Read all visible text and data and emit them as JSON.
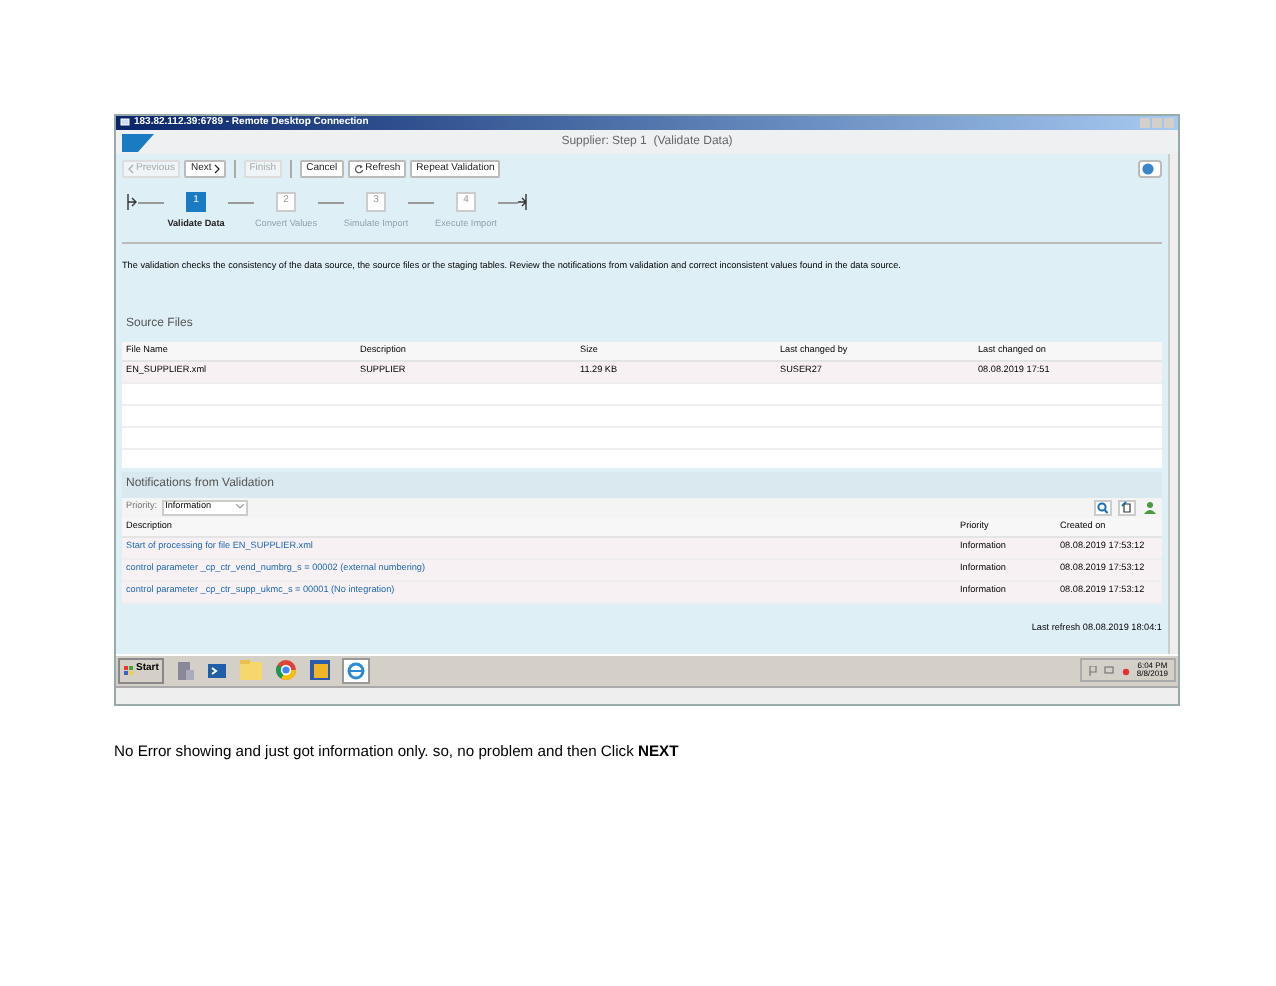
{
  "window": {
    "title": "183.82.112.39:6789 - Remote Desktop Connection"
  },
  "app": {
    "title": "Supplier: Step 1  (Validate Data)"
  },
  "toolbar": [
    {
      "kind": "back",
      "label": "Previous",
      "disabled": true
    },
    {
      "kind": "forward",
      "label": "Next",
      "disabled": false
    },
    {
      "kind": "plain",
      "label": "Finish",
      "disabled": true,
      "separator_before": true
    },
    {
      "kind": "plain",
      "label": "Cancel",
      "disabled": false,
      "separator_before": true
    },
    {
      "kind": "refresh",
      "label": "Refresh",
      "disabled": false
    },
    {
      "kind": "plain",
      "label": "Repeat Validation",
      "disabled": false
    }
  ],
  "roadmap": [
    {
      "number": "1",
      "label": "Validate Data",
      "selected": true
    },
    {
      "number": "2",
      "label": "Convert Values",
      "selected": false
    },
    {
      "number": "3",
      "label": "Simulate Import",
      "selected": false
    },
    {
      "number": "4",
      "label": "Execute Import",
      "selected": false
    }
  ],
  "intro": "The validation checks the consistency of the data source, the source files or the staging tables. Review the notifications from validation and correct inconsistent values found in the data source.",
  "source_files": {
    "title": "Source Files",
    "columns": [
      "File Name",
      "Description",
      "Size",
      "Last changed by",
      "Last changed on"
    ],
    "rows": [
      [
        "EN_SUPPLIER.xml",
        "SUPPLIER",
        "11.29 KB",
        "SUSER27",
        "08.08.2019 17:51"
      ]
    ]
  },
  "notifications": {
    "title": "Notifications from Validation",
    "filter": {
      "label": "Priority:",
      "value": "Information"
    },
    "columns": [
      "Description",
      "Priority",
      "Created on"
    ],
    "rows": [
      [
        "Start of processing for file EN_SUPPLIER.xml",
        "Information",
        "08.08.2019 17:53:12"
      ],
      [
        "control parameter _cp_ctr_vend_numbrg_s = 00002  (external numbering)",
        "Information",
        "08.08.2019 17:53:12"
      ],
      [
        "control parameter _cp_ctr_supp_ukmc_s = 00001  (No integration)",
        "Information",
        "08.08.2019 17:53:12"
      ]
    ]
  },
  "last_refresh": "Last refresh 08.08.2019 18:04:1",
  "taskbar": {
    "start": "Start",
    "time": "6:04 PM",
    "date": "8/8/2019"
  },
  "caption": "No Error showing and just got information only. so, no problem and then Click **NEXT**"
}
